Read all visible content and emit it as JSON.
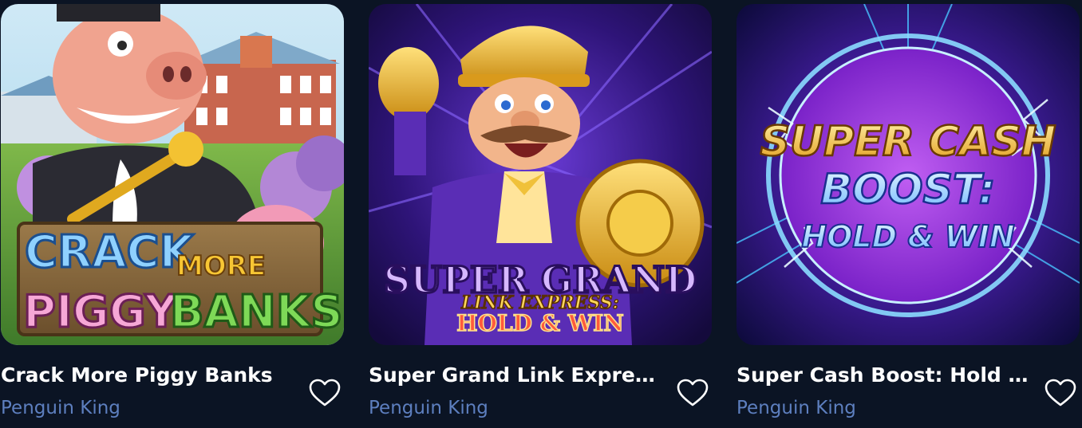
{
  "colors": {
    "background": "#0b1424",
    "title": "#ffffff",
    "provider": "#5d7fbf",
    "heart_outline": "#ffffff"
  },
  "games": [
    {
      "title": "Crack More Piggy Banks",
      "provider": "Penguin King",
      "art": {
        "line1": "CRACK",
        "line2": "MORE",
        "line3": "PIGGY",
        "line4": "BANKS"
      },
      "favorite_icon": "heart-outline-icon"
    },
    {
      "title": "Super Grand Link Expres...",
      "provider": "Penguin King",
      "art": {
        "line1": "SUPER GRAND",
        "line2": "LINK EXPRESS:",
        "line3": "HOLD & WIN"
      },
      "favorite_icon": "heart-outline-icon"
    },
    {
      "title": "Super Cash Boost: Hold ...",
      "provider": "Penguin King",
      "art": {
        "line1": "SUPER CASH",
        "line2": "BOOST:",
        "line3": "HOLD & WIN"
      },
      "favorite_icon": "heart-outline-icon"
    }
  ]
}
